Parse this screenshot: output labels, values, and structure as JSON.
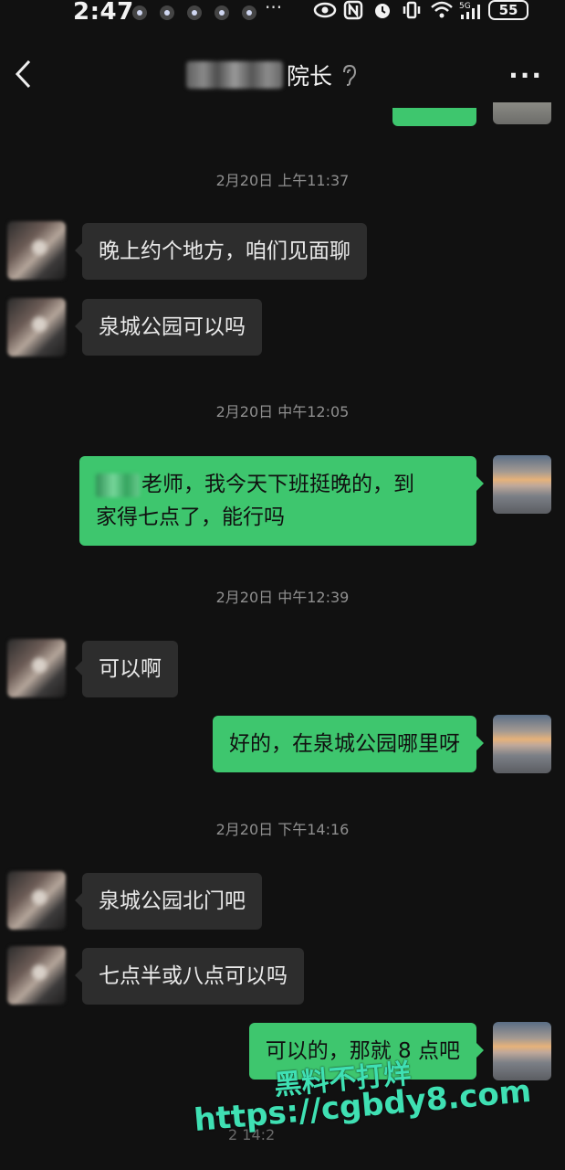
{
  "status_bar": {
    "time": "2:47",
    "overflow": "···",
    "battery": "55",
    "icons": [
      "eye-icon",
      "nfc-icon",
      "alarm-icon",
      "vibrate-icon",
      "wifi-icon",
      "signal-5g-icon"
    ]
  },
  "header": {
    "contact_name_visible": "院长"
  },
  "messages": [
    {
      "type": "timestamp",
      "text": "2月20日 上午11:37"
    },
    {
      "type": "incoming",
      "text": "晚上约个地方，咱们见面聊"
    },
    {
      "type": "incoming",
      "text": "泉城公园可以吗"
    },
    {
      "type": "timestamp",
      "text": "2月20日 中午12:05"
    },
    {
      "type": "outgoing",
      "line1": "老师，我今天下班挺晚的，到",
      "line2": "家得七点了，能行吗"
    },
    {
      "type": "timestamp",
      "text": "2月20日 中午12:39"
    },
    {
      "type": "incoming",
      "text": "可以啊"
    },
    {
      "type": "outgoing",
      "text": "好的，在泉城公园哪里呀"
    },
    {
      "type": "timestamp",
      "text": "2月20日 下午14:16"
    },
    {
      "type": "incoming",
      "text": "泉城公园北门吧"
    },
    {
      "type": "incoming",
      "text": "七点半或八点可以吗"
    },
    {
      "type": "outgoing",
      "text": "可以的，那就 8 点吧"
    }
  ],
  "watermark": {
    "line1": "黑料不打烊",
    "line2": "https://cgbdy8.com"
  },
  "bottom_timestamp_partial": "2   14:2"
}
